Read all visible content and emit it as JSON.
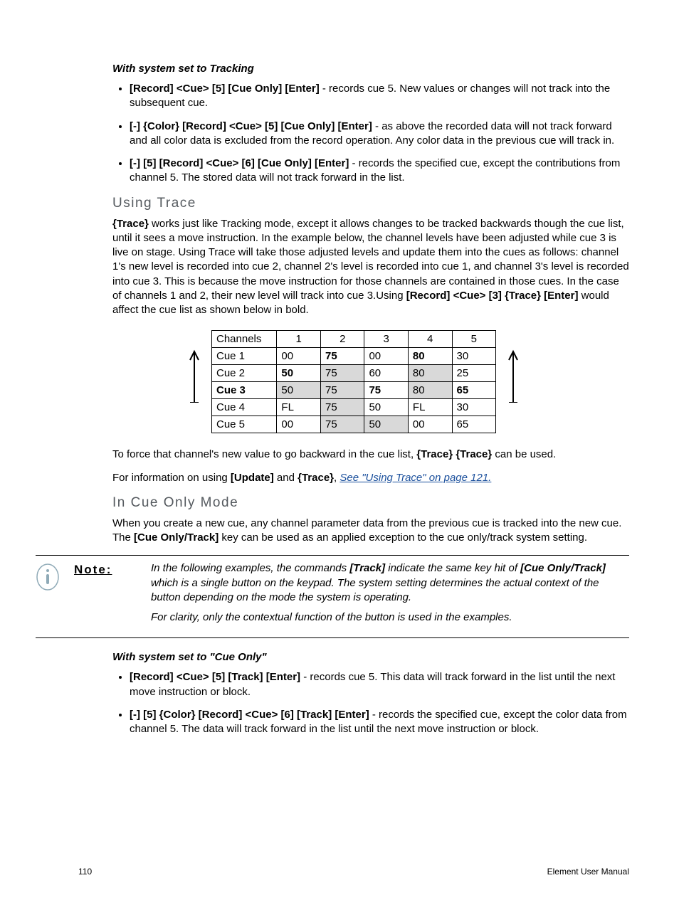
{
  "section1_title": "With system set to Tracking",
  "bullets_tracking": [
    {
      "cmd": "[Record] <Cue> [5] [Cue Only] [Enter]",
      "desc": " - records cue 5. New values or changes will not track into the subsequent cue."
    },
    {
      "cmd": "[-] {Color} [Record] <Cue> [5] [Cue Only] [Enter]",
      "desc": " - as above the recorded data will not track forward and all color data is excluded from the record operation. Any color data in the previous cue will track in."
    },
    {
      "cmd": "[-] [5] [Record] <Cue> [6] [Cue Only] [Enter]",
      "desc": " - records the specified cue, except the contributions from channel 5. The stored data will not track forward in the list."
    }
  ],
  "heading_trace": "Using Trace",
  "trace_para_lead": "{Trace}",
  "trace_para_body1": " works just like Tracking mode, except it allows changes to be tracked backwards though the cue list, until it sees a move instruction. In the example below, the channel levels have been adjusted while cue 3 is live on stage. Using Trace will take those adjusted levels and update them into the cues as follows: channel 1's new level is recorded into cue 2, channel 2's level is recorded into cue 1, and channel 3's level is recorded into cue 3. This is because the move instruction for those channels are contained in those cues. In the case of channels 1 and 2, their new level will track into cue 3.Using ",
  "trace_para_cmd": "[Record] <Cue> [3] {Trace} [Enter]",
  "trace_para_body2": " would affect the cue list as shown below in bold.",
  "table": {
    "head": [
      "Channels",
      "1",
      "2",
      "3",
      "4",
      "5"
    ],
    "rows": [
      {
        "label": "Cue 1",
        "bold_label": false,
        "cells": [
          {
            "v": "00",
            "b": false,
            "g": false
          },
          {
            "v": "75",
            "b": true,
            "g": false
          },
          {
            "v": "00",
            "b": false,
            "g": false
          },
          {
            "v": "80",
            "b": true,
            "g": false
          },
          {
            "v": "30",
            "b": false,
            "g": false
          }
        ]
      },
      {
        "label": "Cue 2",
        "bold_label": false,
        "cells": [
          {
            "v": "50",
            "b": true,
            "g": false
          },
          {
            "v": "75",
            "b": false,
            "g": true
          },
          {
            "v": "60",
            "b": false,
            "g": false
          },
          {
            "v": "80",
            "b": false,
            "g": true
          },
          {
            "v": "25",
            "b": false,
            "g": false
          }
        ]
      },
      {
        "label": "Cue 3",
        "bold_label": true,
        "cells": [
          {
            "v": "50",
            "b": false,
            "g": true
          },
          {
            "v": "75",
            "b": false,
            "g": true
          },
          {
            "v": "75",
            "b": true,
            "g": false
          },
          {
            "v": "80",
            "b": false,
            "g": true
          },
          {
            "v": "65",
            "b": true,
            "g": false
          }
        ]
      },
      {
        "label": "Cue 4",
        "bold_label": false,
        "cells": [
          {
            "v": "FL",
            "b": false,
            "g": false
          },
          {
            "v": "75",
            "b": false,
            "g": true
          },
          {
            "v": "50",
            "b": false,
            "g": false
          },
          {
            "v": "FL",
            "b": false,
            "g": false
          },
          {
            "v": "30",
            "b": false,
            "g": false
          }
        ]
      },
      {
        "label": "Cue 5",
        "bold_label": false,
        "cells": [
          {
            "v": "00",
            "b": false,
            "g": false
          },
          {
            "v": "75",
            "b": false,
            "g": true
          },
          {
            "v": "50",
            "b": false,
            "g": true
          },
          {
            "v": "00",
            "b": false,
            "g": false
          },
          {
            "v": "65",
            "b": false,
            "g": false
          }
        ]
      }
    ]
  },
  "trace_force_pre": "To force that channel's new value to go backward in the cue list, ",
  "trace_force_cmd": "{Trace} {Trace}",
  "trace_force_post": " can be used.",
  "trace_info_pre": "For information on using ",
  "trace_info_cmd1": "[Update]",
  "trace_info_and": " and ",
  "trace_info_cmd2": "{Trace}",
  "trace_info_comma": ", ",
  "trace_link": "See \"Using Trace\" on page 121.",
  "heading_cueonly": "In Cue Only Mode",
  "cueonly_para_pre": "When you create a new cue, any channel parameter data from the previous cue is tracked into the new cue. The ",
  "cueonly_para_cmd": "[Cue Only/Track]",
  "cueonly_para_post": " key can be used as an applied exception to the cue only/track system setting.",
  "note_label": "Note:",
  "note_p1_pre": "In the following examples, the commands ",
  "note_p1_cmd1": "[Track]",
  "note_p1_mid": " indicate the same key hit of ",
  "note_p1_cmd2": "[Cue Only/Track]",
  "note_p1_post": " which is a single button on the keypad. The system setting determines the actual context of the button depending on the mode the system is operating.",
  "note_p2": "For clarity, only the contextual function of the button is used in the examples.",
  "section2_title": "With system set to \"Cue Only\"",
  "bullets_cueonly": [
    {
      "cmd": "[Record] <Cue> [5] [Track] [Enter]",
      "desc": " - records cue 5. This data will track forward in the list until the next move instruction or block."
    },
    {
      "cmd": "[-] [5] {Color} [Record] <Cue> [6] [Track] [Enter]",
      "desc": " - records the specified cue, except the color data from channel 5. The data will track forward in the list until the next move instruction or block."
    }
  ],
  "footer_page": "110",
  "footer_manual": "Element User Manual"
}
